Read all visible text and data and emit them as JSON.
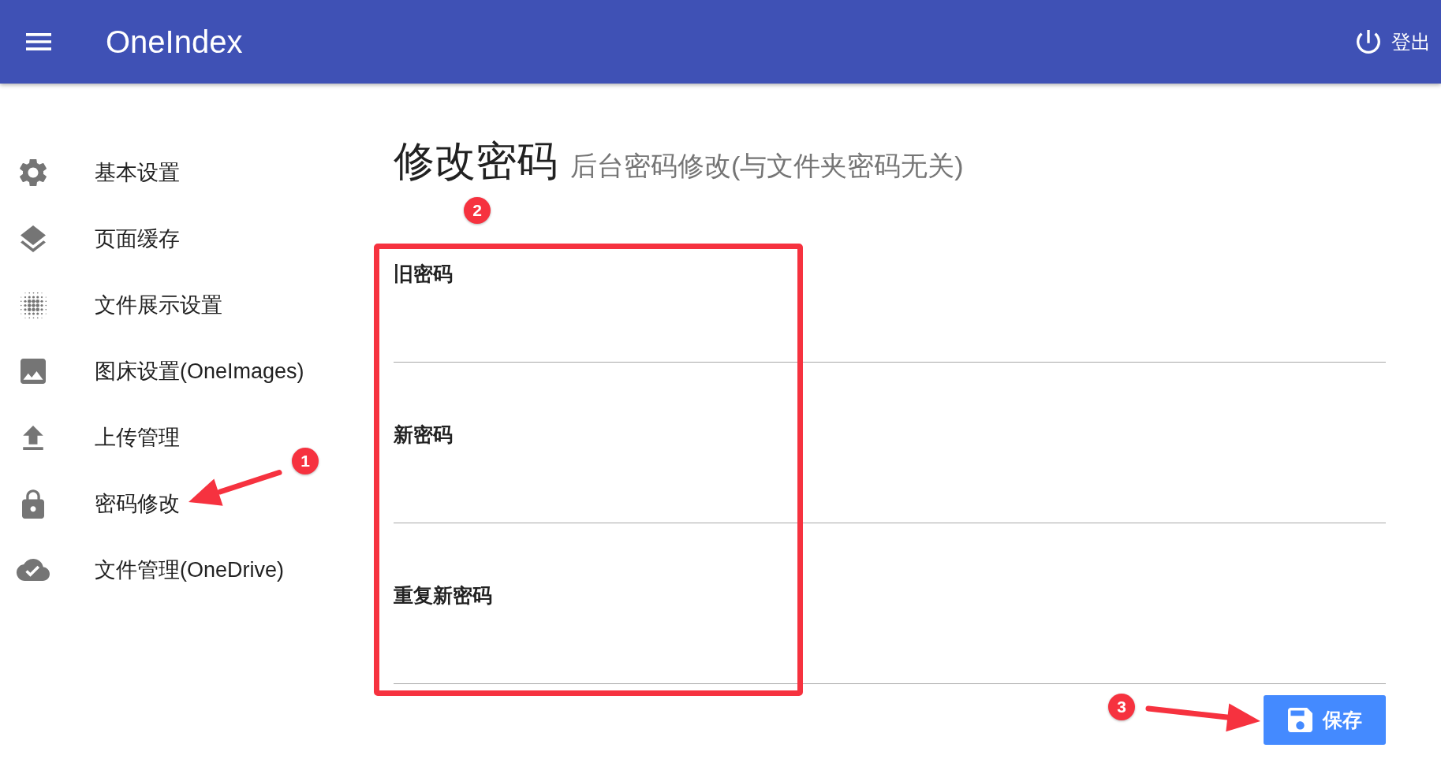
{
  "header": {
    "title": "OneIndex",
    "logout_label": "登出"
  },
  "sidebar": {
    "items": [
      {
        "label": "基本设置"
      },
      {
        "label": "页面缓存"
      },
      {
        "label": "文件展示设置"
      },
      {
        "label": "图床设置(OneImages)"
      },
      {
        "label": "上传管理"
      },
      {
        "label": "密码修改"
      },
      {
        "label": "文件管理(OneDrive)"
      }
    ]
  },
  "page": {
    "title": "修改密码",
    "subtitle": "后台密码修改(与文件夹密码无关)"
  },
  "form": {
    "fields": [
      {
        "label": "旧密码"
      },
      {
        "label": "新密码"
      },
      {
        "label": "重复新密码"
      }
    ],
    "save_button": "保存"
  },
  "annotations": {
    "markers": [
      "1",
      "2",
      "3"
    ]
  }
}
